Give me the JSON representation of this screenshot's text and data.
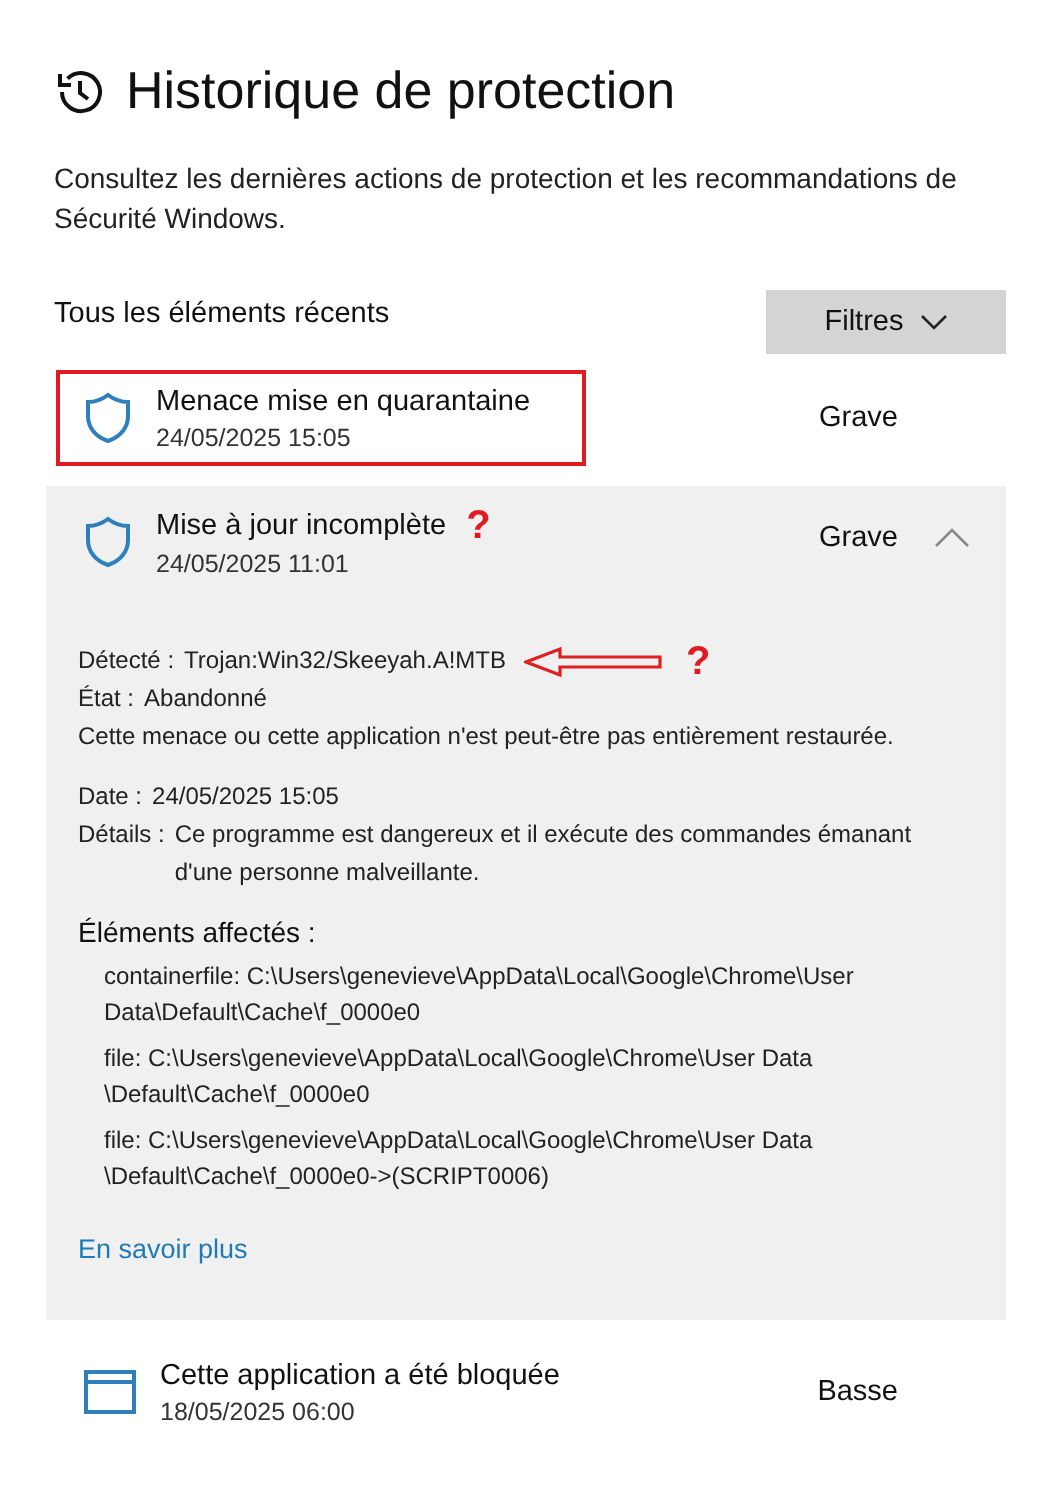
{
  "page": {
    "title": "Historique de protection",
    "description": "Consultez les dernières actions de protection et les recommandations de Sécurité Windows."
  },
  "list_header": {
    "label": "Tous les éléments récents",
    "filter_button": "Filtres"
  },
  "items": [
    {
      "kind": "shield",
      "title": "Menace mise en quarantaine",
      "date": "24/05/2025 15:05",
      "severity": "Grave",
      "expanded": false,
      "highlighted": true
    },
    {
      "kind": "shield",
      "title": "Mise à jour incomplète",
      "title_note": "?",
      "date": "24/05/2025 11:01",
      "severity": "Grave",
      "expanded": true,
      "highlighted": false,
      "details": {
        "detected_label": "Détecté :",
        "detected": "Trojan:Win32/Skeeyah.A!MTB",
        "detected_note": "?",
        "state_label": "État :",
        "state": "Abandonné",
        "message": "Cette menace ou cette application n'est peut-être pas entièrement restaurée.",
        "date_label": "Date :",
        "date": "24/05/2025 15:05",
        "details_label": "Détails :",
        "details": "Ce programme est dangereux et il exécute des commandes émanant d'une personne malveillante.",
        "affected_heading": "Éléments affectés :",
        "affected": [
          [
            "containerfile: C:\\Users\\genevieve\\AppData\\Local\\Google\\Chrome\\User",
            "Data\\Default\\Cache\\f_0000e0"
          ],
          [
            "file: C:\\Users\\genevieve\\AppData\\Local\\Google\\Chrome\\User Data",
            "\\Default\\Cache\\f_0000e0"
          ],
          [
            "file: C:\\Users\\genevieve\\AppData\\Local\\Google\\Chrome\\User Data",
            "\\Default\\Cache\\f_0000e0->(SCRIPT0006)"
          ]
        ],
        "link": "En savoir plus"
      }
    },
    {
      "kind": "app",
      "title": "Cette application a été bloquée",
      "date": "18/05/2025 06:00",
      "severity": "Basse",
      "expanded": false,
      "highlighted": false
    }
  ]
}
